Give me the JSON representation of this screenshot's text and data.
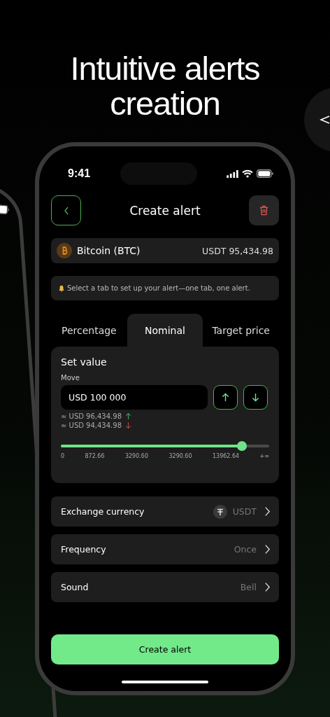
{
  "headline": "Intuitive alerts creation",
  "status_bar": {
    "time": "9:41"
  },
  "header": {
    "title": "Create alert"
  },
  "coin": {
    "name": "Bitcoin (BTC)",
    "price": "USDT 95,434.98"
  },
  "hint": "Select a tab to set up your alert—one tab, one alert.",
  "tabs": [
    {
      "label": "Percentage",
      "selected": false
    },
    {
      "label": "Nominal",
      "selected": true
    },
    {
      "label": "Target price",
      "selected": false
    }
  ],
  "set_value": {
    "title": "Set value",
    "label": "Move",
    "value": "USD 100 000"
  },
  "estimates": [
    {
      "text": "≈ USD 96,434.98",
      "kind": "up"
    },
    {
      "text": "≈ USD 94,434.98",
      "kind": "down"
    }
  ],
  "slider": {
    "level": 0.87,
    "labels": [
      "0",
      "872.66",
      "3290.60",
      "3290.60",
      "13962.64",
      "+∞"
    ]
  },
  "settings": [
    {
      "label": "Exchange currency",
      "value": "USDT",
      "kind": "currency"
    },
    {
      "label": "Frequency",
      "value": "Once",
      "kind": "plain"
    },
    {
      "label": "Sound",
      "value": "Bell",
      "kind": "plain"
    }
  ],
  "button": "Create alert"
}
